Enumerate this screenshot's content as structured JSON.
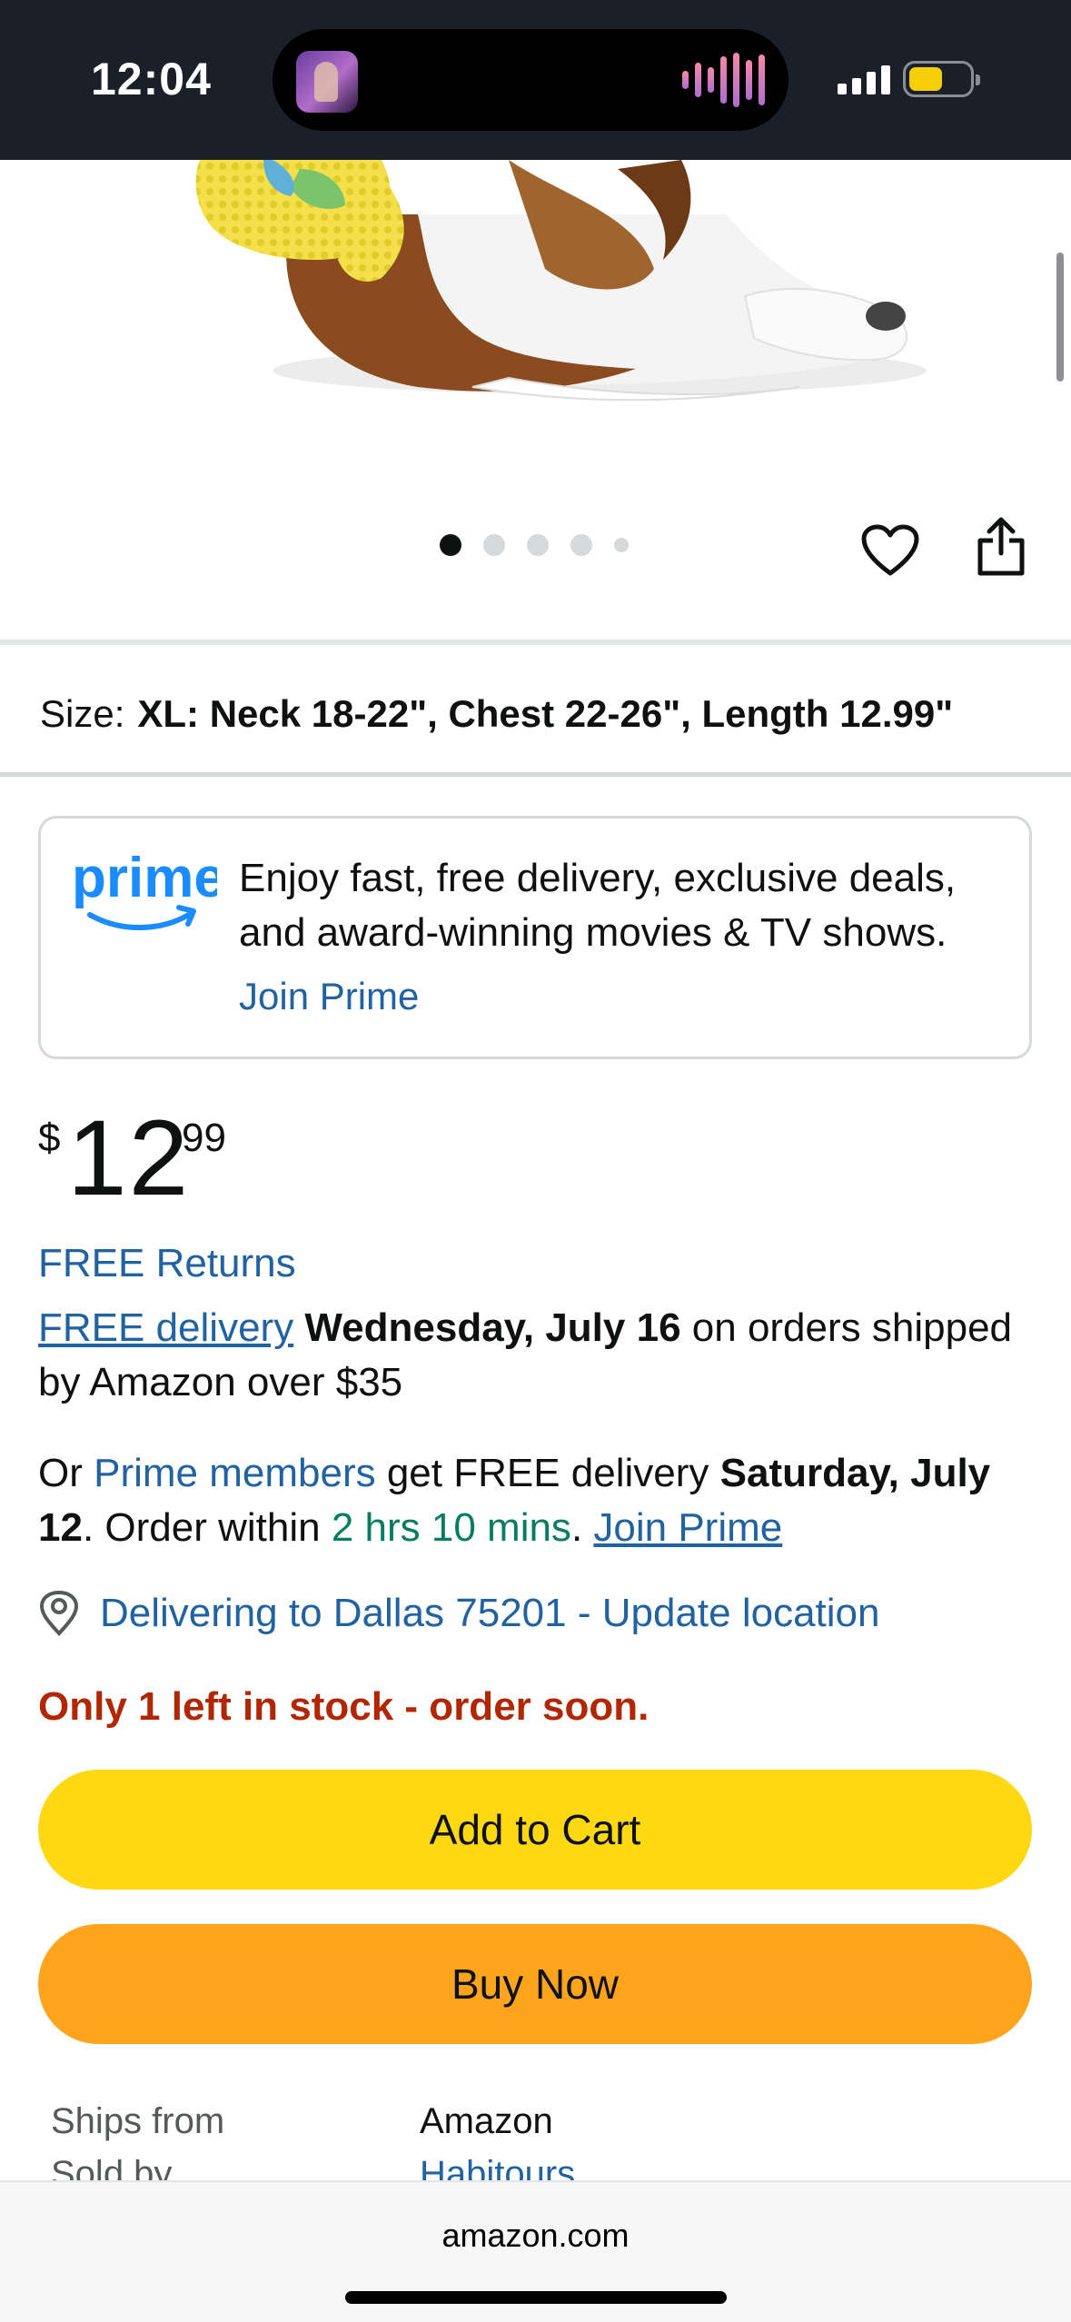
{
  "status_bar": {
    "time": "12:04"
  },
  "product_image": {
    "description_icon": "dog-in-yellow-costume-image",
    "carousel_count": 5,
    "carousel_active_index": 0
  },
  "size": {
    "label": "Size:",
    "value": "XL: Neck 18-22\", Chest 22-26\", Length 12.99\""
  },
  "prime_promo": {
    "logo_text": "prime",
    "text": "Enjoy fast, free delivery, exclusive deals, and award-winning movies & TV shows.",
    "link": "Join Prime"
  },
  "price": {
    "currency": "$",
    "whole": "12",
    "fraction": "99"
  },
  "free_returns": "FREE Returns",
  "delivery": {
    "link": "FREE delivery",
    "date": "Wednesday, July 16",
    "rest": " on orders shipped by Amazon over $35"
  },
  "prime_delivery": {
    "prefix": "Or ",
    "members_link": "Prime members",
    "mid": " get FREE delivery ",
    "date": "Saturday, July 12",
    "order_within": ". Order within ",
    "countdown": "2 hrs 10 mins",
    "period": ". ",
    "join_link": "Join Prime"
  },
  "location": {
    "text": "Delivering to Dallas 75201 - Update location"
  },
  "stock": "Only 1 left in stock - order soon.",
  "buttons": {
    "add_to_cart": "Add to Cart",
    "buy_now": "Buy Now"
  },
  "seller_info": {
    "ships_from_label": "Ships from",
    "ships_from_value": "Amazon",
    "sold_by_label": "Sold by",
    "sold_by_value": "Habitours"
  },
  "browser": {
    "url": "amazon.com"
  },
  "colors": {
    "add_to_cart": "#ffd814",
    "buy_now": "#ffa41c",
    "link": "#2162a1",
    "stock_warning": "#b12704",
    "countdown": "#067d62",
    "prime_blue": "#1a8cff"
  }
}
